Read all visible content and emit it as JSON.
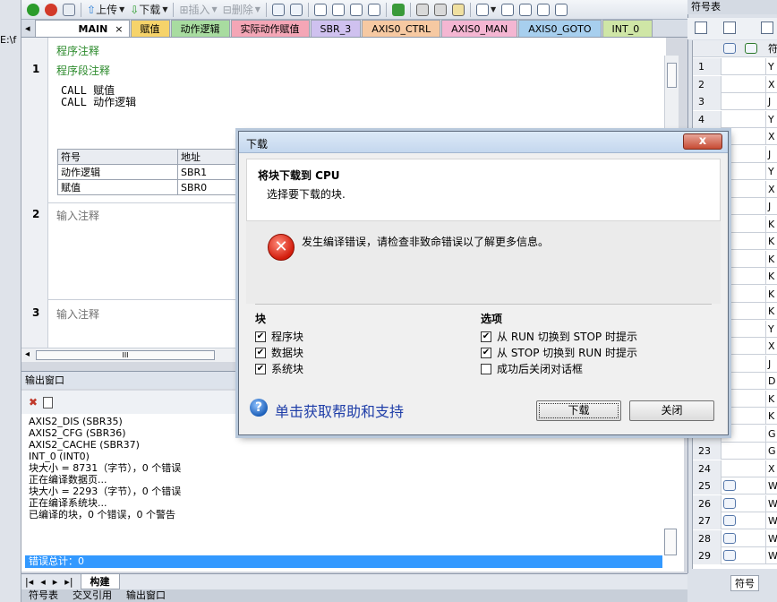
{
  "left_strip": {
    "label": "E:\\f"
  },
  "toolbar": {
    "upload_label": "上传",
    "download_label": "下载",
    "insert_label": "插入",
    "delete_label": "删除"
  },
  "tabs": [
    {
      "label": "MAIN",
      "color": "#ffffff"
    },
    {
      "label": "赋值",
      "color": "#f6d36a"
    },
    {
      "label": "动作逻辑",
      "color": "#a8dca0"
    },
    {
      "label": "实际动作赋值",
      "color": "#f4a6b6"
    },
    {
      "label": "SBR_3",
      "color": "#cfc1ef"
    },
    {
      "label": "AXIS0_CTRL",
      "color": "#f6c9a2"
    },
    {
      "label": "AXIS0_MAN",
      "color": "#f4b6d2"
    },
    {
      "label": "AXIS0_GOTO",
      "color": "#a7cfee"
    },
    {
      "label": "INT_0",
      "color": "#cfe6a6"
    }
  ],
  "editor": {
    "program_comment": "程序注释",
    "network1_num": "1",
    "network1_comment": "程序段注释",
    "code_lines": [
      "CALL    赋值",
      "CALL    动作逻辑"
    ],
    "symbol_table": {
      "headers": [
        "符号",
        "地址"
      ],
      "rows": [
        [
          "动作逻辑",
          "SBR1"
        ],
        [
          "赋值",
          "SBR0"
        ]
      ]
    },
    "network2_num": "2",
    "network2_comment": "输入注释",
    "network3_num": "3",
    "network3_comment": "输入注释",
    "hscroll_thumb": "III"
  },
  "output": {
    "title": "输出窗口",
    "lines": [
      "AXIS2_DIS (SBR35)",
      "AXIS2_CFG (SBR36)",
      "AXIS2_CACHE (SBR37)",
      "INT_0 (INT0)",
      "块大小 = 8731（字节），0 个错误",
      "",
      "正在编译数据页...",
      "块大小 = 2293（字节），0 个错误",
      "",
      "正在编译系统块...",
      "已编译的块，0 个错误，0 个警告"
    ],
    "error_total": "错误总计：0",
    "tab_build": "构建",
    "bottom_tabs": [
      "符号表",
      "交叉引用",
      "输出窗口"
    ]
  },
  "right_panel": {
    "title": "符号表",
    "header_sym": "符",
    "rows": [
      {
        "num": "1",
        "sym": "Y",
        "icon": false
      },
      {
        "num": "2",
        "sym": "X",
        "icon": false
      },
      {
        "num": "3",
        "sym": "J",
        "icon": false
      },
      {
        "num": "4",
        "sym": "Y",
        "icon": false
      },
      {
        "num": "",
        "sym": "X",
        "icon": false
      },
      {
        "num": "",
        "sym": "J",
        "icon": false
      },
      {
        "num": "",
        "sym": "Y",
        "icon": false
      },
      {
        "num": "",
        "sym": "X",
        "icon": false
      },
      {
        "num": "",
        "sym": "J",
        "icon": false
      },
      {
        "num": "",
        "sym": "K",
        "icon": false
      },
      {
        "num": "",
        "sym": "K",
        "icon": false
      },
      {
        "num": "",
        "sym": "K",
        "icon": false
      },
      {
        "num": "",
        "sym": "K",
        "icon": false
      },
      {
        "num": "",
        "sym": "K",
        "icon": false
      },
      {
        "num": "",
        "sym": "K",
        "icon": false
      },
      {
        "num": "",
        "sym": "Y",
        "icon": false
      },
      {
        "num": "",
        "sym": "X",
        "icon": false
      },
      {
        "num": "",
        "sym": "J",
        "icon": false
      },
      {
        "num": "",
        "sym": "D",
        "icon": false
      },
      {
        "num": "",
        "sym": "K",
        "icon": false
      },
      {
        "num": "",
        "sym": "K",
        "icon": false
      },
      {
        "num": "",
        "sym": "G",
        "icon": false
      },
      {
        "num": "23",
        "sym": "G",
        "icon": false
      },
      {
        "num": "24",
        "sym": "X",
        "icon": false
      },
      {
        "num": "25",
        "sym": "W",
        "icon": true
      },
      {
        "num": "26",
        "sym": "W",
        "icon": true
      },
      {
        "num": "27",
        "sym": "W",
        "icon": true
      },
      {
        "num": "28",
        "sym": "W",
        "icon": true
      },
      {
        "num": "29",
        "sym": "W",
        "icon": true
      }
    ],
    "bottom_tab": "符号"
  },
  "dialog": {
    "title": "下载",
    "close_glyph": "x",
    "header_title": "将块下载到 CPU",
    "header_sub": "选择要下载的块.",
    "error_message": "发生编译错误，请检查非致命错误以了解更多信息。",
    "blocks_title": "块",
    "blocks": [
      {
        "label": "程序块",
        "checked": true
      },
      {
        "label": "数据块",
        "checked": true
      },
      {
        "label": "系统块",
        "checked": true
      }
    ],
    "options_title": "选项",
    "options": [
      {
        "label": "从 RUN 切换到 STOP 时提示",
        "checked": true
      },
      {
        "label": "从 STOP 切换到 RUN 时提示",
        "checked": true
      },
      {
        "label": "成功后关闭对话框",
        "checked": false
      }
    ],
    "help_link": "单击获取帮助和支持",
    "download_button": "下载",
    "close_button": "关闭"
  }
}
